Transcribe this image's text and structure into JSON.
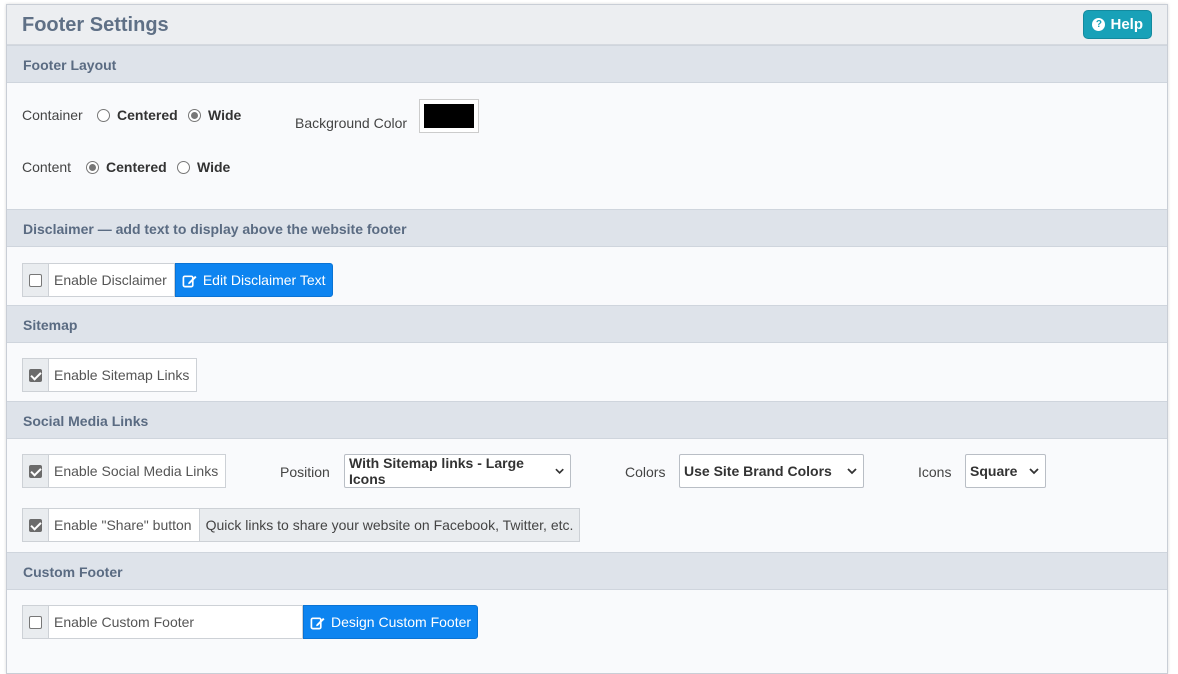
{
  "panel": {
    "title": "Footer Settings",
    "help_label": "Help"
  },
  "layout": {
    "header": "Footer Layout",
    "container_label": "Container",
    "content_label": "Content",
    "opt_centered": "Centered",
    "opt_wide": "Wide",
    "container_value": "Wide",
    "content_value": "Centered",
    "bg_label": "Background Color",
    "bg_color": "#000000"
  },
  "disclaimer": {
    "header": "Disclaimer — add text to display above the website footer",
    "enable_label": "Enable Disclaimer",
    "enabled": false,
    "edit_button": "Edit Disclaimer Text"
  },
  "sitemap": {
    "header": "Sitemap",
    "enable_label": "Enable Sitemap Links",
    "enabled": true
  },
  "social": {
    "header": "Social Media Links",
    "enable_label": "Enable Social Media Links",
    "enabled": true,
    "position_label": "Position",
    "position_value": "With Sitemap links - Large Icons",
    "colors_label": "Colors",
    "colors_value": "Use Site Brand Colors",
    "icons_label": "Icons",
    "icons_value": "Square",
    "share_label": "Enable \"Share\" button",
    "share_enabled": true,
    "share_info": "Quick links to share your website on Facebook, Twitter, etc."
  },
  "custom": {
    "header": "Custom Footer",
    "enable_label": "Enable Custom Footer",
    "enabled": false,
    "design_button": "Design Custom Footer"
  },
  "colors": {
    "accent": "#0d84f0",
    "help": "#18a1b8",
    "section_bg": "#dee3ea"
  }
}
